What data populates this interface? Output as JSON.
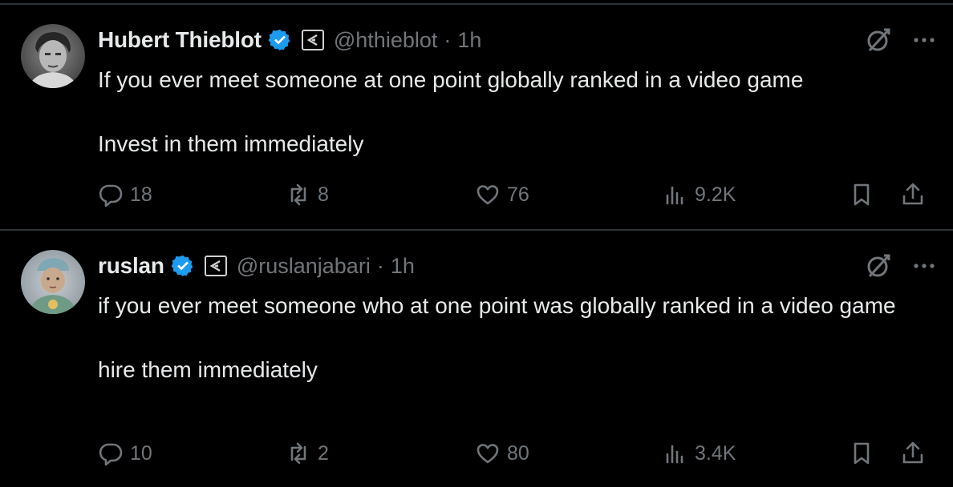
{
  "tweets": [
    {
      "display_name": "Hubert Thieblot",
      "handle": "@hthieblot",
      "separator": "·",
      "time": "1h",
      "verified_icon": "verified-badge-icon",
      "affiliation_icon": "affiliation-badge-icon",
      "text_lines": [
        "If you ever meet someone at one point globally ranked in a video game",
        "Invest in them immediately"
      ],
      "replies": "18",
      "reposts": "8",
      "likes": "76",
      "views": "9.2K"
    },
    {
      "display_name": "ruslan",
      "handle": "@ruslanjabari",
      "separator": "·",
      "time": "1h",
      "verified_icon": "verified-badge-icon",
      "affiliation_icon": "affiliation-badge-icon",
      "text_lines": [
        "if you ever meet someone who at one point was globally ranked in a video game",
        "hire them immediately"
      ],
      "replies": "10",
      "reposts": "2",
      "likes": "80",
      "views": "3.4K"
    }
  ],
  "colors": {
    "background": "#000000",
    "text": "#e7e9ea",
    "muted": "#71767b",
    "verified": "#1d9bf0",
    "divider": "#2f3336"
  },
  "icons": [
    "reply-icon",
    "repost-icon",
    "like-icon",
    "views-icon",
    "bookmark-icon",
    "share-icon",
    "grok-icon",
    "more-icon"
  ]
}
